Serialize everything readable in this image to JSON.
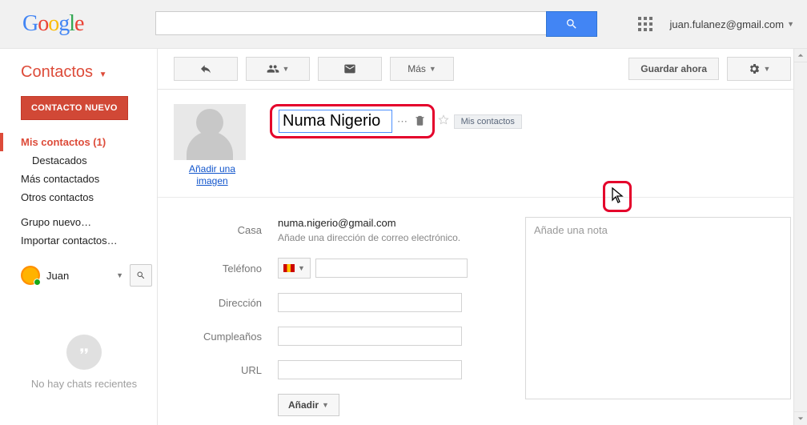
{
  "top": {
    "logo_letters": [
      "G",
      "o",
      "o",
      "g",
      "l",
      "e"
    ],
    "search_value": "",
    "account": "juan.fulanez@gmail.com"
  },
  "sidebar": {
    "title": "Contactos",
    "new_button": "CONTACTO NUEVO",
    "my_contacts": "Mis contactos (1)",
    "featured": "Destacados",
    "most_contacted": "Más contactados",
    "other_contacts": "Otros contactos",
    "new_group": "Grupo nuevo…",
    "import": "Importar contactos…",
    "profile_name": "Juan",
    "hangouts_empty": "No hay chats recientes"
  },
  "toolbar": {
    "more_label": "Más",
    "save_label": "Guardar ahora"
  },
  "contact": {
    "name": "Numa Nigerio",
    "add_image": "Añadir una imagen",
    "group_tag": "Mis contactos",
    "fields": {
      "email_label": "Casa",
      "email_value": "numa.nigerio@gmail.com",
      "email_hint": "Añade una dirección de correo electrónico.",
      "phone_label": "Teléfono",
      "address_label": "Dirección",
      "birthday_label": "Cumpleaños",
      "url_label": "URL",
      "add_button": "Añadir"
    },
    "notes_placeholder": "Añade una nota"
  }
}
